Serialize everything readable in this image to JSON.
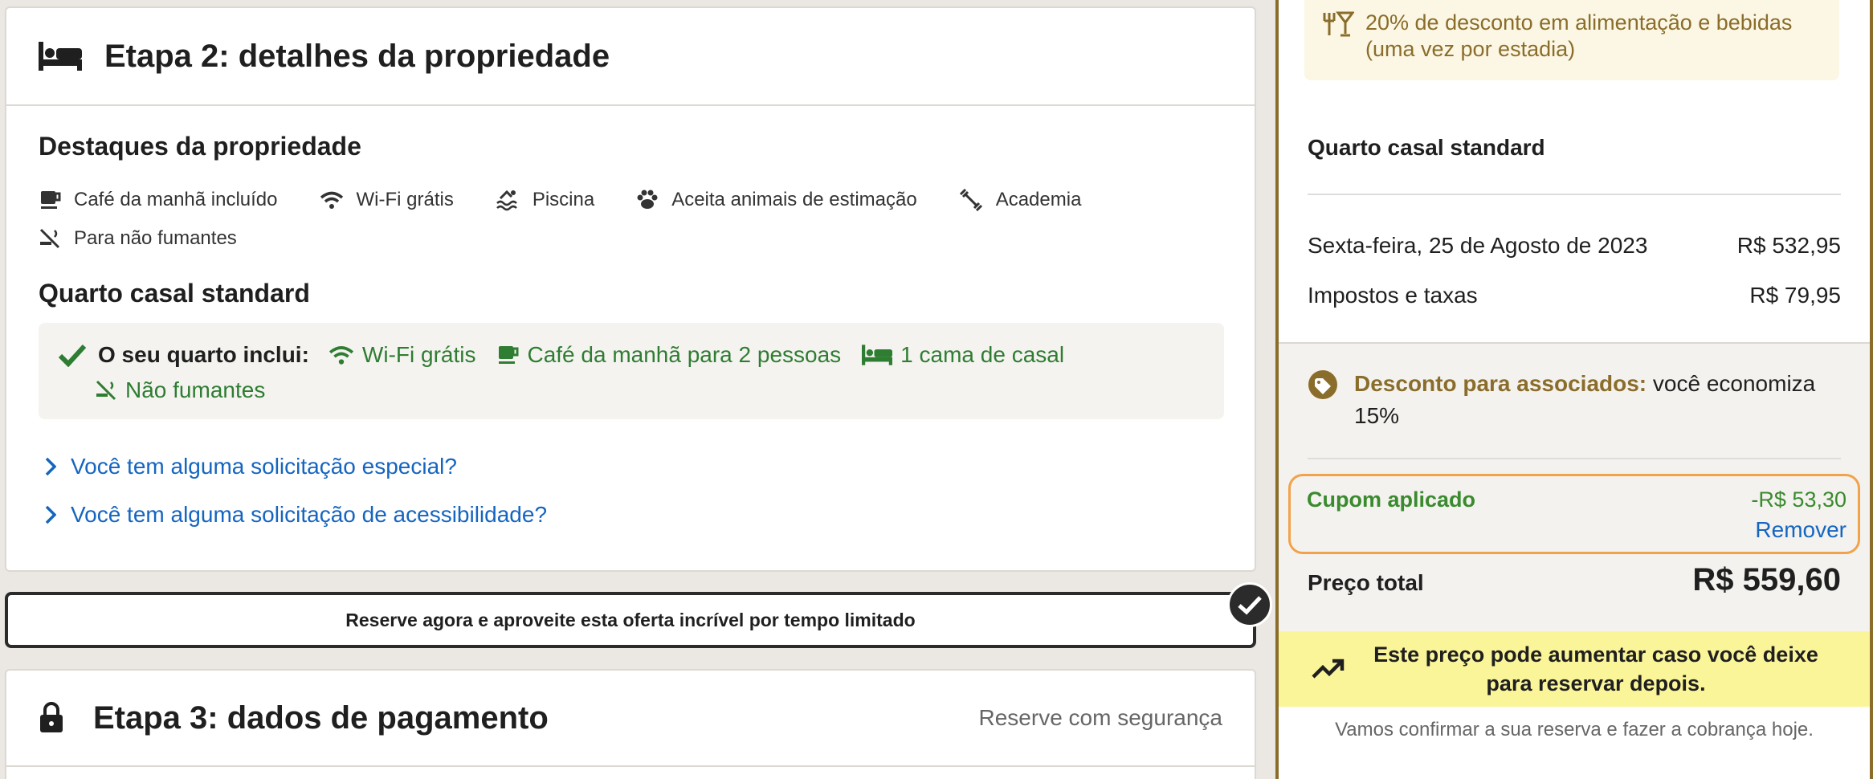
{
  "step2": {
    "title": "Etapa 2: detalhes da propriedade",
    "highlights_title": "Destaques da propriedade",
    "highlights": [
      {
        "icon": "coffee-icon",
        "label": "Café da manhã incluído"
      },
      {
        "icon": "wifi-icon",
        "label": "Wi-Fi grátis"
      },
      {
        "icon": "pool-icon",
        "label": "Piscina"
      },
      {
        "icon": "paw-icon",
        "label": "Aceita animais de estimação"
      },
      {
        "icon": "gym-icon",
        "label": "Academia"
      },
      {
        "icon": "no-smoking-icon",
        "label": "Para não fumantes"
      }
    ],
    "room_title": "Quarto casal standard",
    "includes_label": "O seu quarto inclui:",
    "includes": [
      {
        "icon": "wifi-icon",
        "label": "Wi-Fi grátis"
      },
      {
        "icon": "coffee-icon",
        "label": "Café da manhã para 2 pessoas"
      },
      {
        "icon": "bed-icon",
        "label": "1 cama de casal"
      },
      {
        "icon": "no-smoking-icon",
        "label": "Não fumantes"
      }
    ],
    "link_special": "Você tem alguma solicitação especial?",
    "link_access": "Você tem alguma solicitação de acessibilidade?"
  },
  "promo": {
    "label": "Reserve agora e aproveite esta oferta incrível por tempo limitado"
  },
  "step3": {
    "title": "Etapa 3: dados de pagamento",
    "secure": "Reserve com segurança"
  },
  "summary": {
    "offer": "20% de desconto em alimentação e bebidas (uma vez por estadia)",
    "room": "Quarto casal standard",
    "date_label": "Sexta-feira, 25 de Agosto de 2023",
    "date_price": "R$ 532,95",
    "tax_label": "Impostos e taxas",
    "tax_price": "R$ 79,95",
    "member_label": "Desconto para associados:",
    "member_text": "você economiza 15%",
    "coupon_label": "Cupom aplicado",
    "coupon_value": "-R$ 53,30",
    "remove": "Remover",
    "total_label": "Preço total",
    "total_value": "R$ 559,60",
    "warning": "Este preço pode aumentar caso você deixe para reservar depois.",
    "confirm": "Vamos confirmar a sua reserva e fazer a cobrança hoje."
  },
  "colors": {
    "gold": "#8a6d2b",
    "green": "#2e7d32",
    "link": "#1565c0",
    "coupon_border": "#f2a24a",
    "warning_bg": "#fbf59a"
  }
}
